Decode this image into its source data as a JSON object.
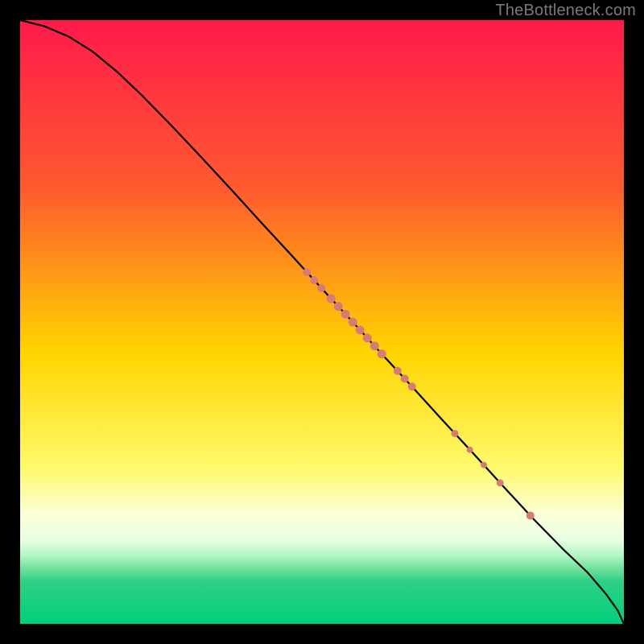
{
  "watermark": "TheBottleneck.com",
  "chart_data": {
    "type": "line",
    "title": "",
    "xlabel": "",
    "ylabel": "",
    "xlim": [
      0,
      100
    ],
    "ylim": [
      0,
      100
    ],
    "background_gradient": {
      "stops": [
        {
          "offset": 0,
          "color": "#ff1a4b"
        },
        {
          "offset": 28,
          "color": "#ff5a2f"
        },
        {
          "offset": 55,
          "color": "#ffd400"
        },
        {
          "offset": 74,
          "color": "#fff96b"
        },
        {
          "offset": 82,
          "color": "#fbffd8"
        },
        {
          "offset": 86,
          "color": "#e8ffe1"
        },
        {
          "offset": 88.5,
          "color": "#b7f7c6"
        },
        {
          "offset": 91,
          "color": "#6bdf9a"
        },
        {
          "offset": 93,
          "color": "#2ecf85"
        },
        {
          "offset": 100,
          "color": "#00d07a"
        }
      ]
    },
    "curve": {
      "name": "main-curve",
      "points": [
        {
          "x": 0.0,
          "y": 100.0
        },
        {
          "x": 4.0,
          "y": 99.0
        },
        {
          "x": 8.0,
          "y": 97.3
        },
        {
          "x": 12.0,
          "y": 94.8
        },
        {
          "x": 16.0,
          "y": 91.5
        },
        {
          "x": 20.0,
          "y": 87.7
        },
        {
          "x": 25.0,
          "y": 82.6
        },
        {
          "x": 30.0,
          "y": 77.3
        },
        {
          "x": 35.0,
          "y": 71.9
        },
        {
          "x": 40.0,
          "y": 66.4
        },
        {
          "x": 45.0,
          "y": 61.0
        },
        {
          "x": 50.0,
          "y": 55.5
        },
        {
          "x": 55.0,
          "y": 50.1
        },
        {
          "x": 60.0,
          "y": 44.6
        },
        {
          "x": 65.0,
          "y": 39.2
        },
        {
          "x": 70.0,
          "y": 33.7
        },
        {
          "x": 75.0,
          "y": 28.3
        },
        {
          "x": 80.0,
          "y": 22.8
        },
        {
          "x": 85.0,
          "y": 17.4
        },
        {
          "x": 90.0,
          "y": 12.3
        },
        {
          "x": 94.0,
          "y": 8.5
        },
        {
          "x": 97.0,
          "y": 5.0
        },
        {
          "x": 99.0,
          "y": 2.2
        },
        {
          "x": 100.0,
          "y": 0.0
        }
      ]
    },
    "marker_clusters": [
      {
        "x_start": 47.5,
        "x_end": 50.0,
        "r": 5.0
      },
      {
        "x_start": 51.5,
        "x_end": 60.5,
        "r": 5.5
      },
      {
        "x_start": 62.5,
        "x_end": 65.0,
        "r": 5.0
      },
      {
        "x_start": 72.0,
        "x_end": 72.0,
        "r": 4.5
      },
      {
        "x_start": 74.5,
        "x_end": 74.5,
        "r": 4.0
      },
      {
        "x_start": 76.8,
        "x_end": 76.8,
        "r": 4.0
      },
      {
        "x_start": 79.5,
        "x_end": 79.5,
        "r": 4.5
      },
      {
        "x_start": 84.5,
        "x_end": 84.5,
        "r": 5.0
      }
    ],
    "marker_color": "#d67c75"
  }
}
